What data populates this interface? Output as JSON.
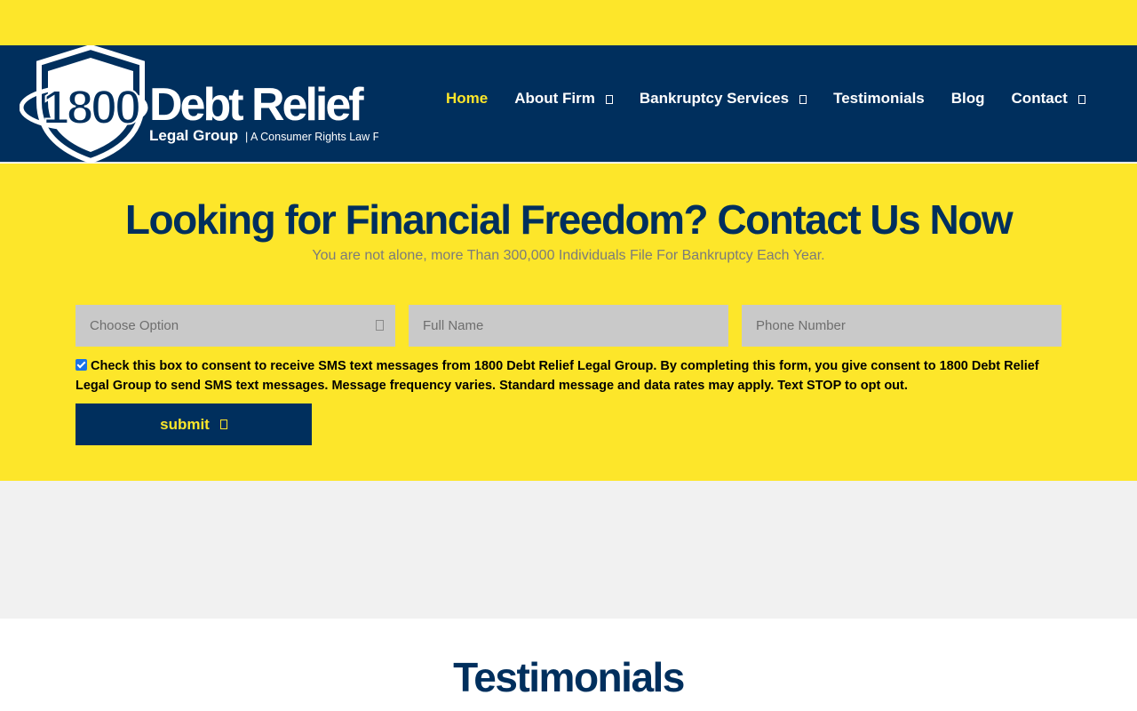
{
  "logo": {
    "number": "1800",
    "brand": "Debt Relief",
    "subbrand": "Legal Group",
    "tagline": "| A Consumer Rights Law Firm"
  },
  "nav": {
    "items": [
      {
        "label": "Home",
        "active": true,
        "has_dropdown": false
      },
      {
        "label": "About Firm",
        "active": false,
        "has_dropdown": true
      },
      {
        "label": "Bankruptcy Services",
        "active": false,
        "has_dropdown": true
      },
      {
        "label": "Testimonials",
        "active": false,
        "has_dropdown": false
      },
      {
        "label": "Blog",
        "active": false,
        "has_dropdown": false
      },
      {
        "label": "Contact",
        "active": false,
        "has_dropdown": true
      }
    ]
  },
  "hero": {
    "title": "Looking for Financial Freedom? Contact Us Now",
    "subtitle": "You are not alone, more Than 300,000 Individuals File For Bankruptcy Each Year."
  },
  "form": {
    "option_select": {
      "value": "Choose Option"
    },
    "full_name": {
      "placeholder": "Full Name"
    },
    "phone": {
      "placeholder": "Phone Number"
    },
    "consent": {
      "checked": true,
      "text": "Check this box to consent to receive SMS text messages from 1800 Debt Relief Legal Group. By completing this form, you give consent to 1800 Debt Relief Legal Group to send SMS text messages. Message frequency varies. Standard message and data rates may apply. Text STOP to opt out."
    },
    "submit_label": "submit"
  },
  "testimonials": {
    "title": "Testimonials"
  },
  "colors": {
    "brand_yellow": "#fde62a",
    "brand_navy": "#002f5d",
    "field_gray": "#c9c9c9",
    "band_gray": "#f1f1f1"
  },
  "icons": {
    "dropdown": "chevron-down-icon",
    "submit": "arrow-right-icon",
    "logo_mark": "shield-icon"
  }
}
